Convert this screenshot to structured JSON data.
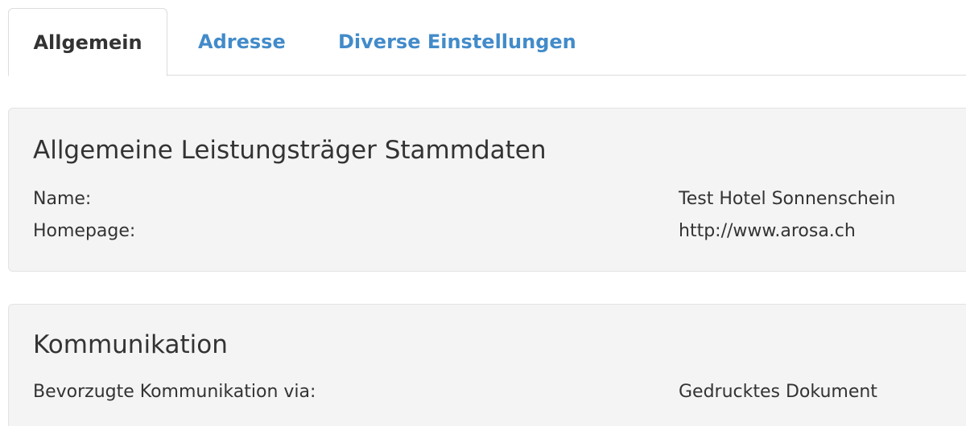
{
  "tabs": [
    {
      "label": "Allgemein",
      "active": true
    },
    {
      "label": "Adresse",
      "active": false
    },
    {
      "label": "Diverse Einstellungen",
      "active": false
    }
  ],
  "stammdaten": {
    "title": "Allgemeine Leistungsträger Stammdaten",
    "rows": [
      {
        "label": "Name:",
        "value": "Test Hotel Sonnenschein"
      },
      {
        "label": "Homepage:",
        "value": "http://www.arosa.ch"
      }
    ]
  },
  "kommunikation": {
    "title": "Kommunikation",
    "rows": [
      {
        "label": "Bevorzugte Kommunikation via:",
        "value": "Gedrucktes Dokument"
      }
    ]
  },
  "colors": {
    "link": "#428bca",
    "text": "#333333",
    "panel_bg": "#f4f4f4",
    "border": "#dddddd"
  }
}
